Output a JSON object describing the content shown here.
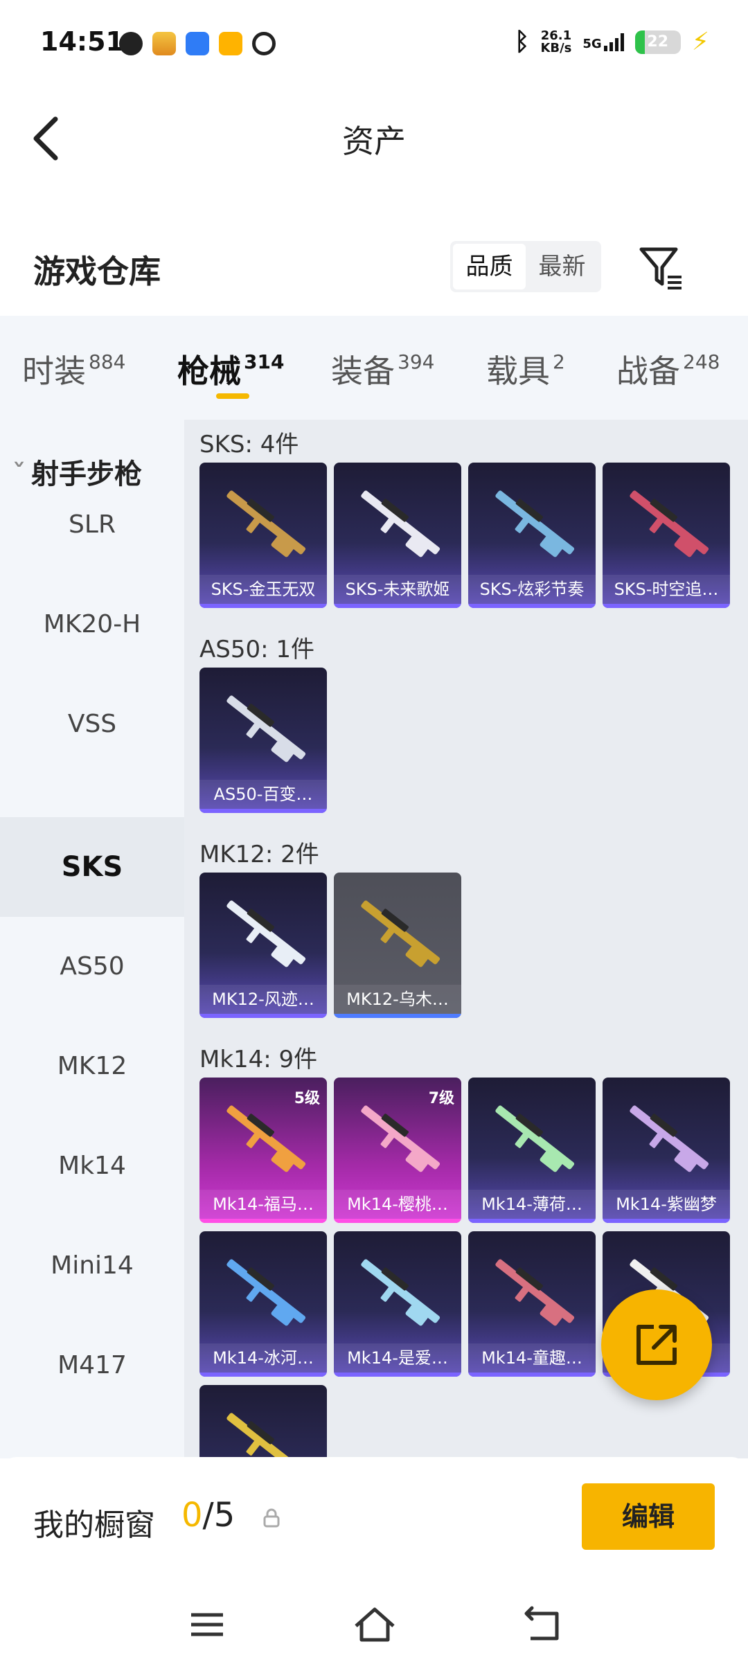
{
  "status_bar": {
    "time": "14:51",
    "net_speed_value": "26.1",
    "net_speed_unit": "KB/s",
    "network": "5G",
    "battery": "22"
  },
  "header": {
    "title": "资产"
  },
  "warehouse": {
    "title": "游戏仓库",
    "sort_options": [
      "品质",
      "最新"
    ]
  },
  "tabs": [
    {
      "label": "时装",
      "count": "884"
    },
    {
      "label": "枪械",
      "count": "314"
    },
    {
      "label": "装备",
      "count": "394"
    },
    {
      "label": "载具",
      "count": "2"
    },
    {
      "label": "战备",
      "count": "248"
    }
  ],
  "sidebar": {
    "group": "射手步枪",
    "items": [
      "SLR",
      "MK20-H",
      "VSS",
      "SKS",
      "AS50",
      "MK12",
      "Mk14",
      "Mini14",
      "M417"
    ],
    "selected": "SKS"
  },
  "sections": [
    {
      "title": "SKS: 4件",
      "cards": [
        {
          "label": "SKS-金玉无双"
        },
        {
          "label": "SKS-未来歌姬"
        },
        {
          "label": "SKS-炫彩节奏"
        },
        {
          "label": "SKS-时空追…"
        }
      ]
    },
    {
      "title": "AS50: 1件",
      "cards": [
        {
          "label": "AS50-百变…"
        }
      ]
    },
    {
      "title": "MK12: 2件",
      "cards": [
        {
          "label": "MK12-风迹…"
        },
        {
          "label": "MK12-乌木…"
        }
      ]
    },
    {
      "title": "Mk14: 9件",
      "cards": [
        {
          "label": "Mk14-福马…",
          "level": "5级"
        },
        {
          "label": "Mk14-樱桃…",
          "level": "7级"
        },
        {
          "label": "Mk14-薄荷…"
        },
        {
          "label": "Mk14-紫幽梦"
        },
        {
          "label": "Mk14-冰河…"
        },
        {
          "label": "Mk14-是爱…"
        },
        {
          "label": "Mk14-童趣…"
        },
        {
          "label": "Mk14-…"
        },
        {
          "label": ""
        }
      ]
    }
  ],
  "showcase": {
    "label": "我的橱窗",
    "current": "0",
    "total": "/5",
    "edit_label": "编辑"
  },
  "colors": {
    "accent": "#f7b400",
    "card_purple": "#5b4bb8",
    "card_pink": "#d23ad6",
    "card_grey": "#5c5d67"
  }
}
